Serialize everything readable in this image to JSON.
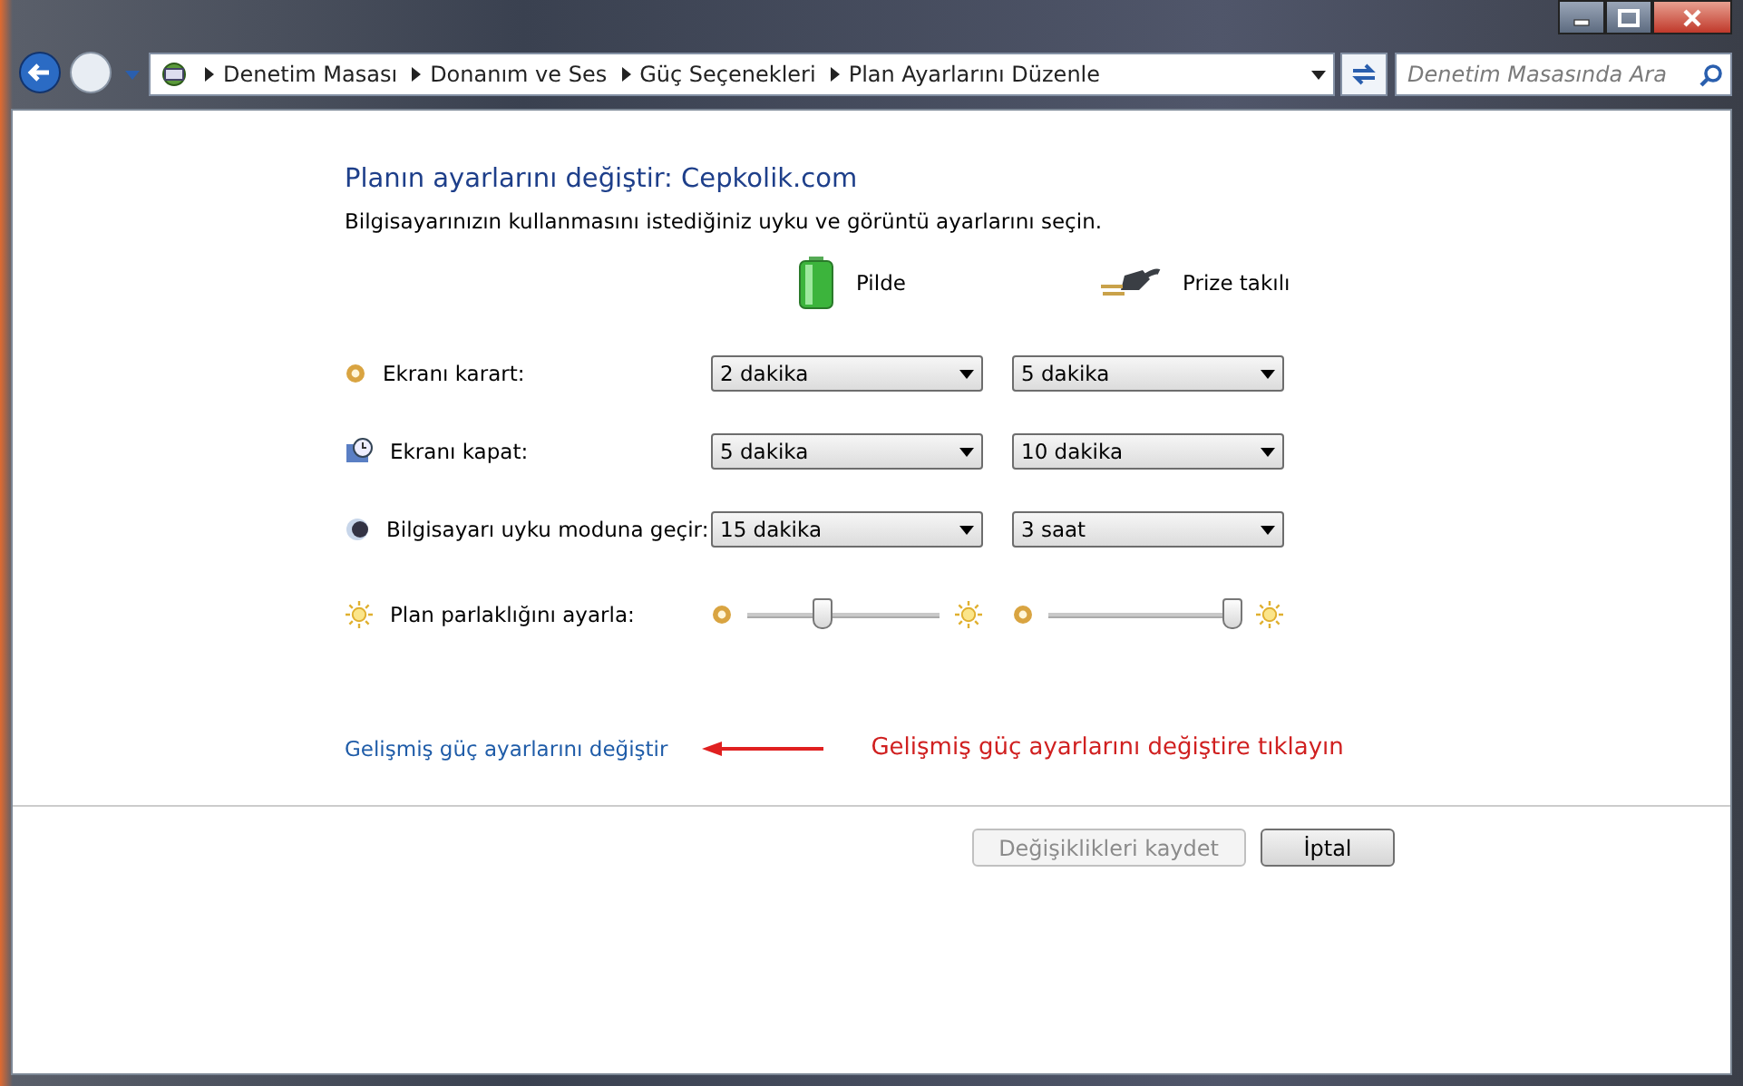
{
  "address_bar": {
    "breadcrumbs": [
      "Denetim Masası",
      "Donanım ve Ses",
      "Güç Seçenekleri",
      "Plan Ayarlarını Düzenle"
    ]
  },
  "search": {
    "placeholder": "Denetim Masasında Ara"
  },
  "heading": "Planın ayarlarını değiştir: Cepkolik.com",
  "description": "Bilgisayarınızın kullanmasını istediğiniz uyku ve görüntü ayarlarını seçin.",
  "columns": [
    {
      "kind": "battery",
      "label": "Pilde"
    },
    {
      "kind": "plug",
      "label": "Prize takılı"
    }
  ],
  "settings": [
    {
      "kind": "dropdown",
      "label": "Ekranı karart:",
      "values": [
        "2 dakika",
        "5 dakika"
      ]
    },
    {
      "kind": "dropdown",
      "label": "Ekranı kapat:",
      "values": [
        "5 dakika",
        "10 dakika"
      ]
    },
    {
      "kind": "dropdown",
      "label": "Bilgisayarı uyku moduna geçir:",
      "values": [
        "15 dakika",
        "3 saat"
      ]
    },
    {
      "kind": "slider",
      "label": "Plan parlaklığını ayarla:",
      "levels": [
        {
          "level": 0.4
        },
        {
          "level": 0.96
        }
      ]
    }
  ],
  "advanced_link": "Gelişmiş güç ayarlarını değiştir",
  "annotation": "Gelişmiş güç ayarlarını değiştire tıklayın",
  "footer_buttons": [
    {
      "label": "Değişiklikleri kaydet",
      "disabled": true
    },
    {
      "label": "İptal",
      "disabled": false
    }
  ]
}
